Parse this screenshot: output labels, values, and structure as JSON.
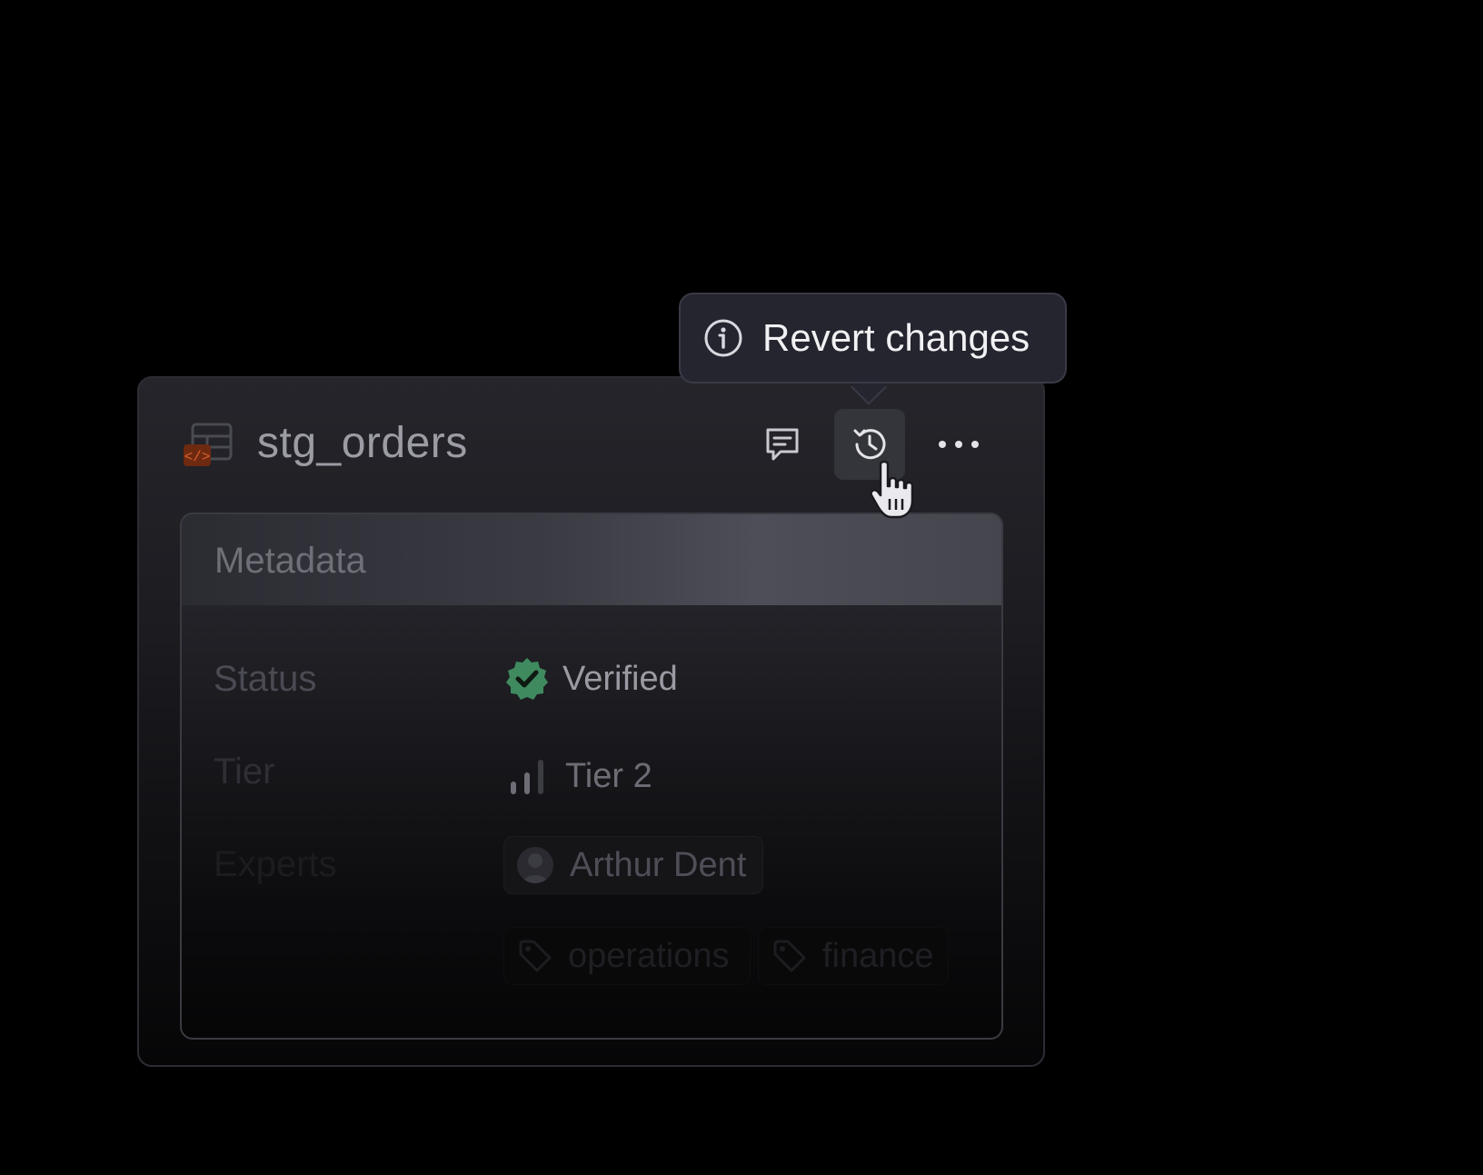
{
  "card": {
    "title": "stg_orders",
    "actions": [
      {
        "name": "comment",
        "icon": "comment-icon"
      },
      {
        "name": "history",
        "icon": "history-icon",
        "hovered": true
      },
      {
        "name": "more",
        "icon": "more-icon"
      }
    ]
  },
  "tooltip": {
    "text": "Revert changes",
    "icon": "info-icon"
  },
  "metadata": {
    "title": "Metadata",
    "status_label": "Status",
    "status_value": "Verified",
    "tier_label": "Tier",
    "tier_value": "Tier 2",
    "experts_label": "Experts",
    "expert_name": "Arthur Dent",
    "tags": [
      "operations",
      "finance"
    ]
  },
  "colors": {
    "verified": "#3f8a5f",
    "dbt_badge": "#b2461c"
  }
}
